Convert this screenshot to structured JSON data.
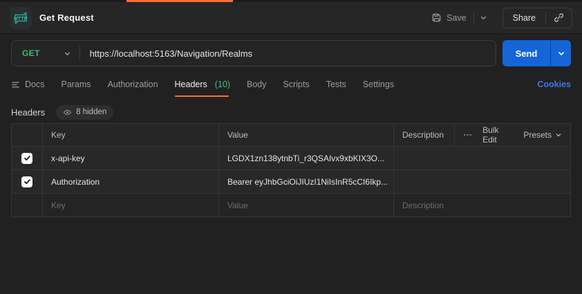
{
  "topbar": {
    "title": "Get Request",
    "save_label": "Save",
    "share_label": "Share"
  },
  "request": {
    "method": "GET",
    "url": "https://localhost:5163/Navigation/Realms",
    "send_label": "Send"
  },
  "tabs": [
    {
      "label": "Docs"
    },
    {
      "label": "Params"
    },
    {
      "label": "Authorization"
    },
    {
      "label": "Headers",
      "count": "(10)",
      "active": true
    },
    {
      "label": "Body"
    },
    {
      "label": "Scripts"
    },
    {
      "label": "Tests"
    },
    {
      "label": "Settings"
    }
  ],
  "cookies_link": "Cookies",
  "headers_section": {
    "title": "Headers",
    "hidden_badge": "8 hidden"
  },
  "table": {
    "columns": {
      "key": "Key",
      "value": "Value",
      "description": "Description"
    },
    "actions": {
      "bulk_edit": "Bulk Edit",
      "presets": "Presets"
    },
    "rows": [
      {
        "checked": true,
        "key": "x-api-key",
        "value": "LGDX1zn138ytnbTi_r3QSAIvx9xbKIX3O...",
        "description": ""
      },
      {
        "checked": true,
        "key": "Authorization",
        "value": "Bearer eyJhbGciOiJIUzI1NiIsInR5cCI6Ikp...",
        "description": ""
      }
    ],
    "placeholder_row": {
      "key": "Key",
      "value": "Value",
      "description": "Description"
    }
  },
  "colors": {
    "accent_orange": "#ff6c37",
    "method_green": "#3eb877",
    "send_blue": "#1565d8",
    "link_blue": "#3d76e8",
    "http_teal": "#2ec5b6"
  }
}
